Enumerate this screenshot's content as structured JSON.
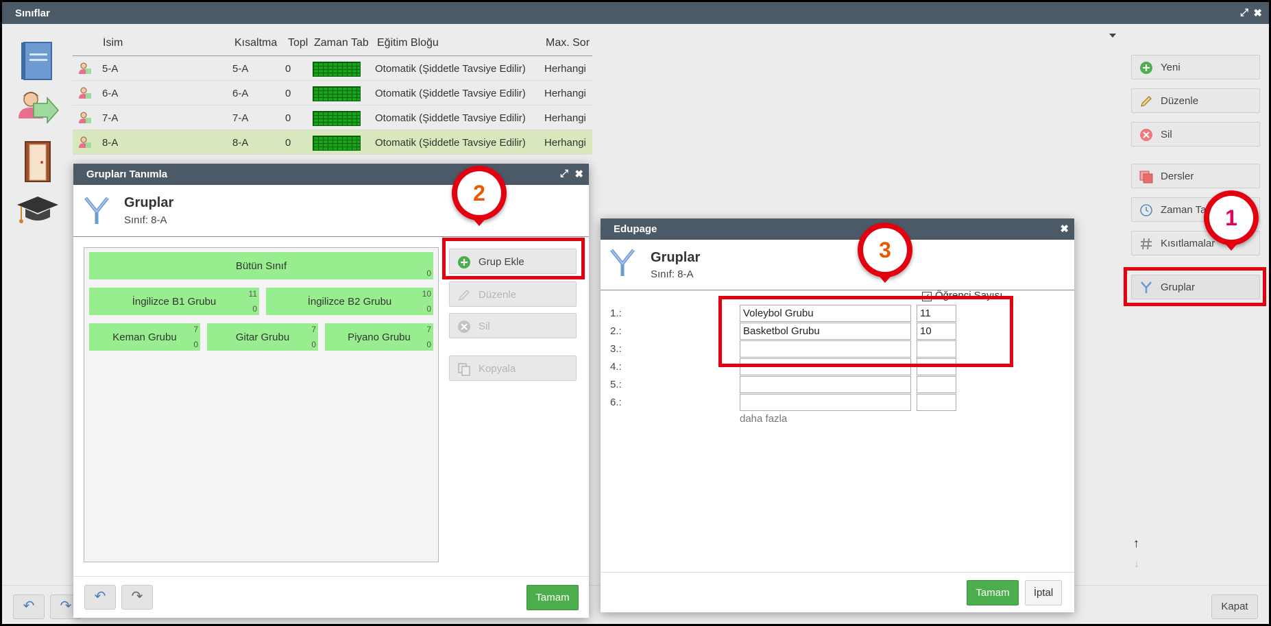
{
  "window": {
    "title": "Sınıflar"
  },
  "table": {
    "headers": [
      "İsim",
      "Kısaltma",
      "Topl",
      "Zaman Tab",
      "Eğitim Bloğu",
      "Max. Sor"
    ],
    "rows": [
      {
        "name": "5-A",
        "short": "5-A",
        "total": "0",
        "block": "Otomatik (Şiddetle Tavsiye Edilir)",
        "max": "Herhangi"
      },
      {
        "name": "6-A",
        "short": "6-A",
        "total": "0",
        "block": "Otomatik (Şiddetle Tavsiye Edilir)",
        "max": "Herhangi"
      },
      {
        "name": "7-A",
        "short": "7-A",
        "total": "0",
        "block": "Otomatik (Şiddetle Tavsiye Edilir)",
        "max": "Herhangi"
      },
      {
        "name": "8-A",
        "short": "8-A",
        "total": "0",
        "block": "Otomatik (Şiddetle Tavsiye Edilir)",
        "max": "Herhangi"
      }
    ]
  },
  "side_buttons": {
    "yeni": "Yeni",
    "duzenle": "Düzenle",
    "sil": "Sil",
    "dersler": "Dersler",
    "zaman": "Zaman Ta",
    "kisitlamalar": "Kısıtlamalar",
    "gruplar": "Gruplar"
  },
  "bottom": {
    "close": "Kapat"
  },
  "group_dialog": {
    "title": "Grupları Tanımla",
    "header": "Gruplar",
    "subheader": "Sınıf: 8-A",
    "whole_class": {
      "name": "Bütün Sınıf",
      "count": "0"
    },
    "row2": [
      {
        "name": "İngilizce B1 Grubu",
        "top": "11",
        "bottom": "0"
      },
      {
        "name": "İngilizce B2 Grubu",
        "top": "10",
        "bottom": "0"
      }
    ],
    "row3": [
      {
        "name": "Keman Grubu",
        "top": "7",
        "bottom": "0"
      },
      {
        "name": "Gitar Grubu",
        "top": "7",
        "bottom": "0"
      },
      {
        "name": "Piyano Grubu",
        "top": "7",
        "bottom": "0"
      }
    ],
    "buttons": {
      "add": "Grup Ekle",
      "edit": "Düzenle",
      "delete": "Sil",
      "copy": "Kopyala"
    },
    "ok": "Tamam"
  },
  "edupage_dialog": {
    "title": "Edupage",
    "header": "Gruplar",
    "subheader": "Sınıf: 8-A",
    "student_count_label": "Öğrenci Sayısı",
    "student_count_checked": true,
    "rows": [
      {
        "label": "1.:",
        "name": "Voleybol Grubu",
        "count": "11"
      },
      {
        "label": "2.:",
        "name": "Basketbol Grubu",
        "count": "10"
      },
      {
        "label": "3.:",
        "name": "",
        "count": ""
      },
      {
        "label": "4.:",
        "name": "",
        "count": ""
      },
      {
        "label": "5.:",
        "name": "",
        "count": ""
      },
      {
        "label": "6.:",
        "name": "",
        "count": ""
      }
    ],
    "more": "daha fazla",
    "ok": "Tamam",
    "cancel": "İptal"
  },
  "annotations": {
    "marker1": "1",
    "marker2": "2",
    "marker3": "3",
    "accent": "#e3000f"
  },
  "colors": {
    "titlebar": "#4b5a66",
    "selected_row": "#d7e8bd",
    "group_tile": "#98ee8e",
    "ok_button": "#4cae4c"
  }
}
